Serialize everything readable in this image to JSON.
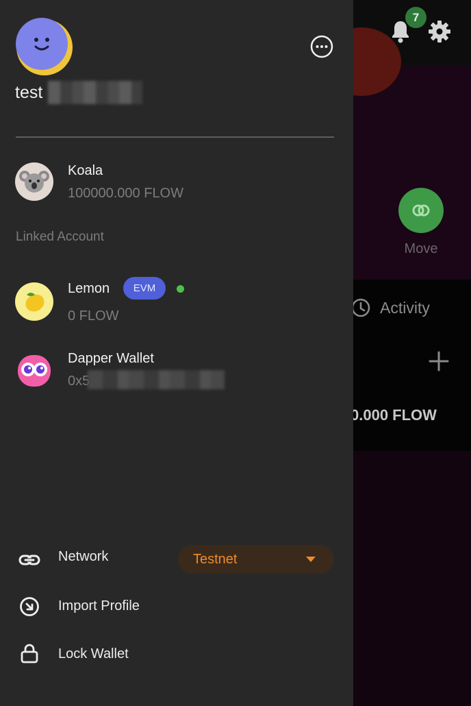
{
  "background": {
    "notification_count": "7",
    "move_label": "Move",
    "activity_label": "Activity",
    "balance_partial": "0.000 FLOW"
  },
  "drawer": {
    "username": "test",
    "accounts": [
      {
        "name": "Koala",
        "balance": "100000.000 FLOW",
        "avatar": "koala-emoji"
      }
    ],
    "linked_section_label": "Linked Account",
    "linked_accounts": [
      {
        "name": "Lemon",
        "badge": "EVM",
        "balance": "0 FLOW",
        "status": "online",
        "avatar": "lemon-emoji"
      },
      {
        "name": "Dapper Wallet",
        "address_prefix": "0x5",
        "avatar": "dapper-wallet-logo"
      }
    ],
    "menu": {
      "network_label": "Network",
      "network_value": "Testnet",
      "import_label": "Import Profile",
      "lock_label": "Lock Wallet"
    }
  },
  "colors": {
    "drawer_bg": "#282828",
    "accent_orange": "#f08b2a",
    "evm_badge": "#4f60d8",
    "online_green": "#4bc24a",
    "move_green": "#3f9a47"
  }
}
